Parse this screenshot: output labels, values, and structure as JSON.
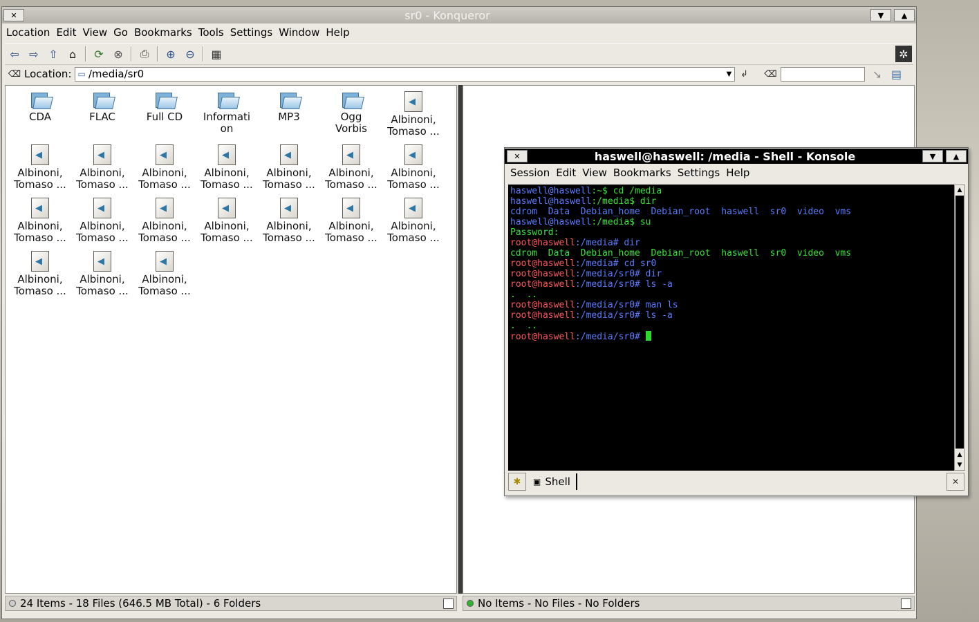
{
  "konqueror": {
    "title": "sr0 - Konqueror",
    "menu": [
      "Location",
      "Edit",
      "View",
      "Go",
      "Bookmarks",
      "Tools",
      "Settings",
      "Window",
      "Help"
    ],
    "location_label": "Location:",
    "location_value": "/media/sr0",
    "left_status": "24 Items - 18 Files (646.5 MB Total) - 6 Folders",
    "right_status": "No Items - No Files - No Folders",
    "items": [
      {
        "label": "CDA",
        "kind": "folder"
      },
      {
        "label": "FLAC",
        "kind": "folder"
      },
      {
        "label": "Full CD",
        "kind": "folder"
      },
      {
        "label": "Informati\non",
        "kind": "folder"
      },
      {
        "label": "MP3",
        "kind": "folder"
      },
      {
        "label": "Ogg\nVorbis",
        "kind": "folder"
      },
      {
        "label": "Albinoni,\nTomaso ...",
        "kind": "audio"
      },
      {
        "label": "Albinoni,\nTomaso ...",
        "kind": "audio"
      },
      {
        "label": "Albinoni,\nTomaso ...",
        "kind": "audio"
      },
      {
        "label": "Albinoni,\nTomaso ...",
        "kind": "audio"
      },
      {
        "label": "Albinoni,\nTomaso ...",
        "kind": "audio"
      },
      {
        "label": "Albinoni,\nTomaso ...",
        "kind": "audio"
      },
      {
        "label": "Albinoni,\nTomaso ...",
        "kind": "audio"
      },
      {
        "label": "Albinoni,\nTomaso ...",
        "kind": "audio"
      },
      {
        "label": "Albinoni,\nTomaso ...",
        "kind": "audio"
      },
      {
        "label": "Albinoni,\nTomaso ...",
        "kind": "audio"
      },
      {
        "label": "Albinoni,\nTomaso ...",
        "kind": "audio"
      },
      {
        "label": "Albinoni,\nTomaso ...",
        "kind": "audio"
      },
      {
        "label": "Albinoni,\nTomaso ...",
        "kind": "audio"
      },
      {
        "label": "Albinoni,\nTomaso ...",
        "kind": "audio"
      },
      {
        "label": "Albinoni,\nTomaso ...",
        "kind": "audio"
      },
      {
        "label": "Albinoni,\nTomaso ...",
        "kind": "audio"
      },
      {
        "label": "Albinoni,\nTomaso ...",
        "kind": "audio"
      },
      {
        "label": "Albinoni,\nTomaso ...",
        "kind": "audio"
      }
    ]
  },
  "konsole": {
    "title": "haswell@haswell: /media - Shell - Konsole",
    "menu": [
      "Session",
      "Edit",
      "View",
      "Bookmarks",
      "Settings",
      "Help"
    ],
    "tab_label": "Shell",
    "lines": [
      [
        [
          "haswell@haswell",
          "b"
        ],
        [
          ":~$ cd /media",
          "g"
        ]
      ],
      [
        [
          "haswell@haswell",
          "b"
        ],
        [
          ":/media$ dir",
          "g"
        ]
      ],
      [
        [
          "cdrom  Data  Debian_home  Debian_root  haswell  sr0  video  vms",
          "b"
        ]
      ],
      [
        [
          "haswell@haswell",
          "b"
        ],
        [
          ":/media$ su",
          "g"
        ]
      ],
      [
        [
          "Password:",
          "g"
        ]
      ],
      [
        [
          "root@haswell",
          "r"
        ],
        [
          ":/media# dir",
          "b"
        ]
      ],
      [
        [
          "cdrom  Data  Debian_home  Debian_root  haswell  sr0  video  vms",
          "g"
        ]
      ],
      [
        [
          "root@haswell",
          "r"
        ],
        [
          ":/media# cd sr0",
          "b"
        ]
      ],
      [
        [
          "root@haswell",
          "r"
        ],
        [
          ":/media/sr0# dir",
          "b"
        ]
      ],
      [
        [
          "root@haswell",
          "r"
        ],
        [
          ":/media/sr0# ls -a",
          "b"
        ]
      ],
      [
        [
          ".  ..",
          "g"
        ]
      ],
      [
        [
          "root@haswell",
          "r"
        ],
        [
          ":/media/sr0# man ls",
          "b"
        ]
      ],
      [
        [
          "root@haswell",
          "r"
        ],
        [
          ":/media/sr0# ls -a",
          "b"
        ]
      ],
      [
        [
          ".  ..",
          "g"
        ]
      ],
      [
        [
          "root@haswell",
          "r"
        ],
        [
          ":/media/sr0# ",
          "b"
        ]
      ]
    ]
  }
}
